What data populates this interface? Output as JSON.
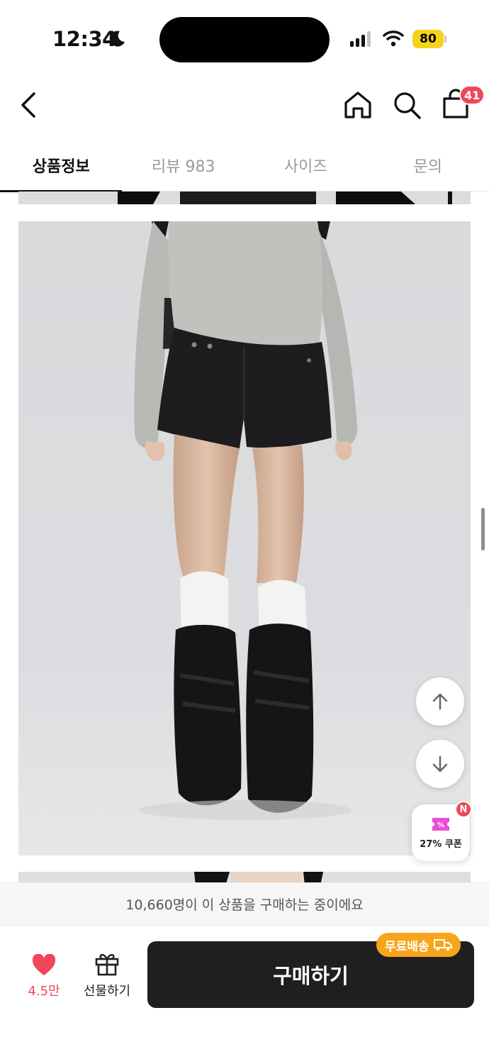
{
  "status_bar": {
    "time": "12:34",
    "battery": "80"
  },
  "nav": {
    "cart_badge": "41"
  },
  "tabs": [
    {
      "label": "상품정보",
      "active": true
    },
    {
      "label": "리뷰 983",
      "active": false
    },
    {
      "label": "사이즈",
      "active": false
    },
    {
      "label": "문의",
      "active": false
    }
  ],
  "floating": {
    "coupon_label": "27% 쿠폰",
    "coupon_badge": "N"
  },
  "notice": "10,660명이 이 상품을 구매하는 중이에요",
  "bottom_bar": {
    "like_count": "4.5만",
    "gift_label": "선물하기",
    "buy_label": "구매하기",
    "shipping_badge": "무료배송"
  },
  "colors": {
    "accent_red": "#f0475a",
    "buy_button": "#1f1f1f",
    "shipping_badge": "#f8a51b",
    "coupon_pink": "#e94fd6"
  }
}
